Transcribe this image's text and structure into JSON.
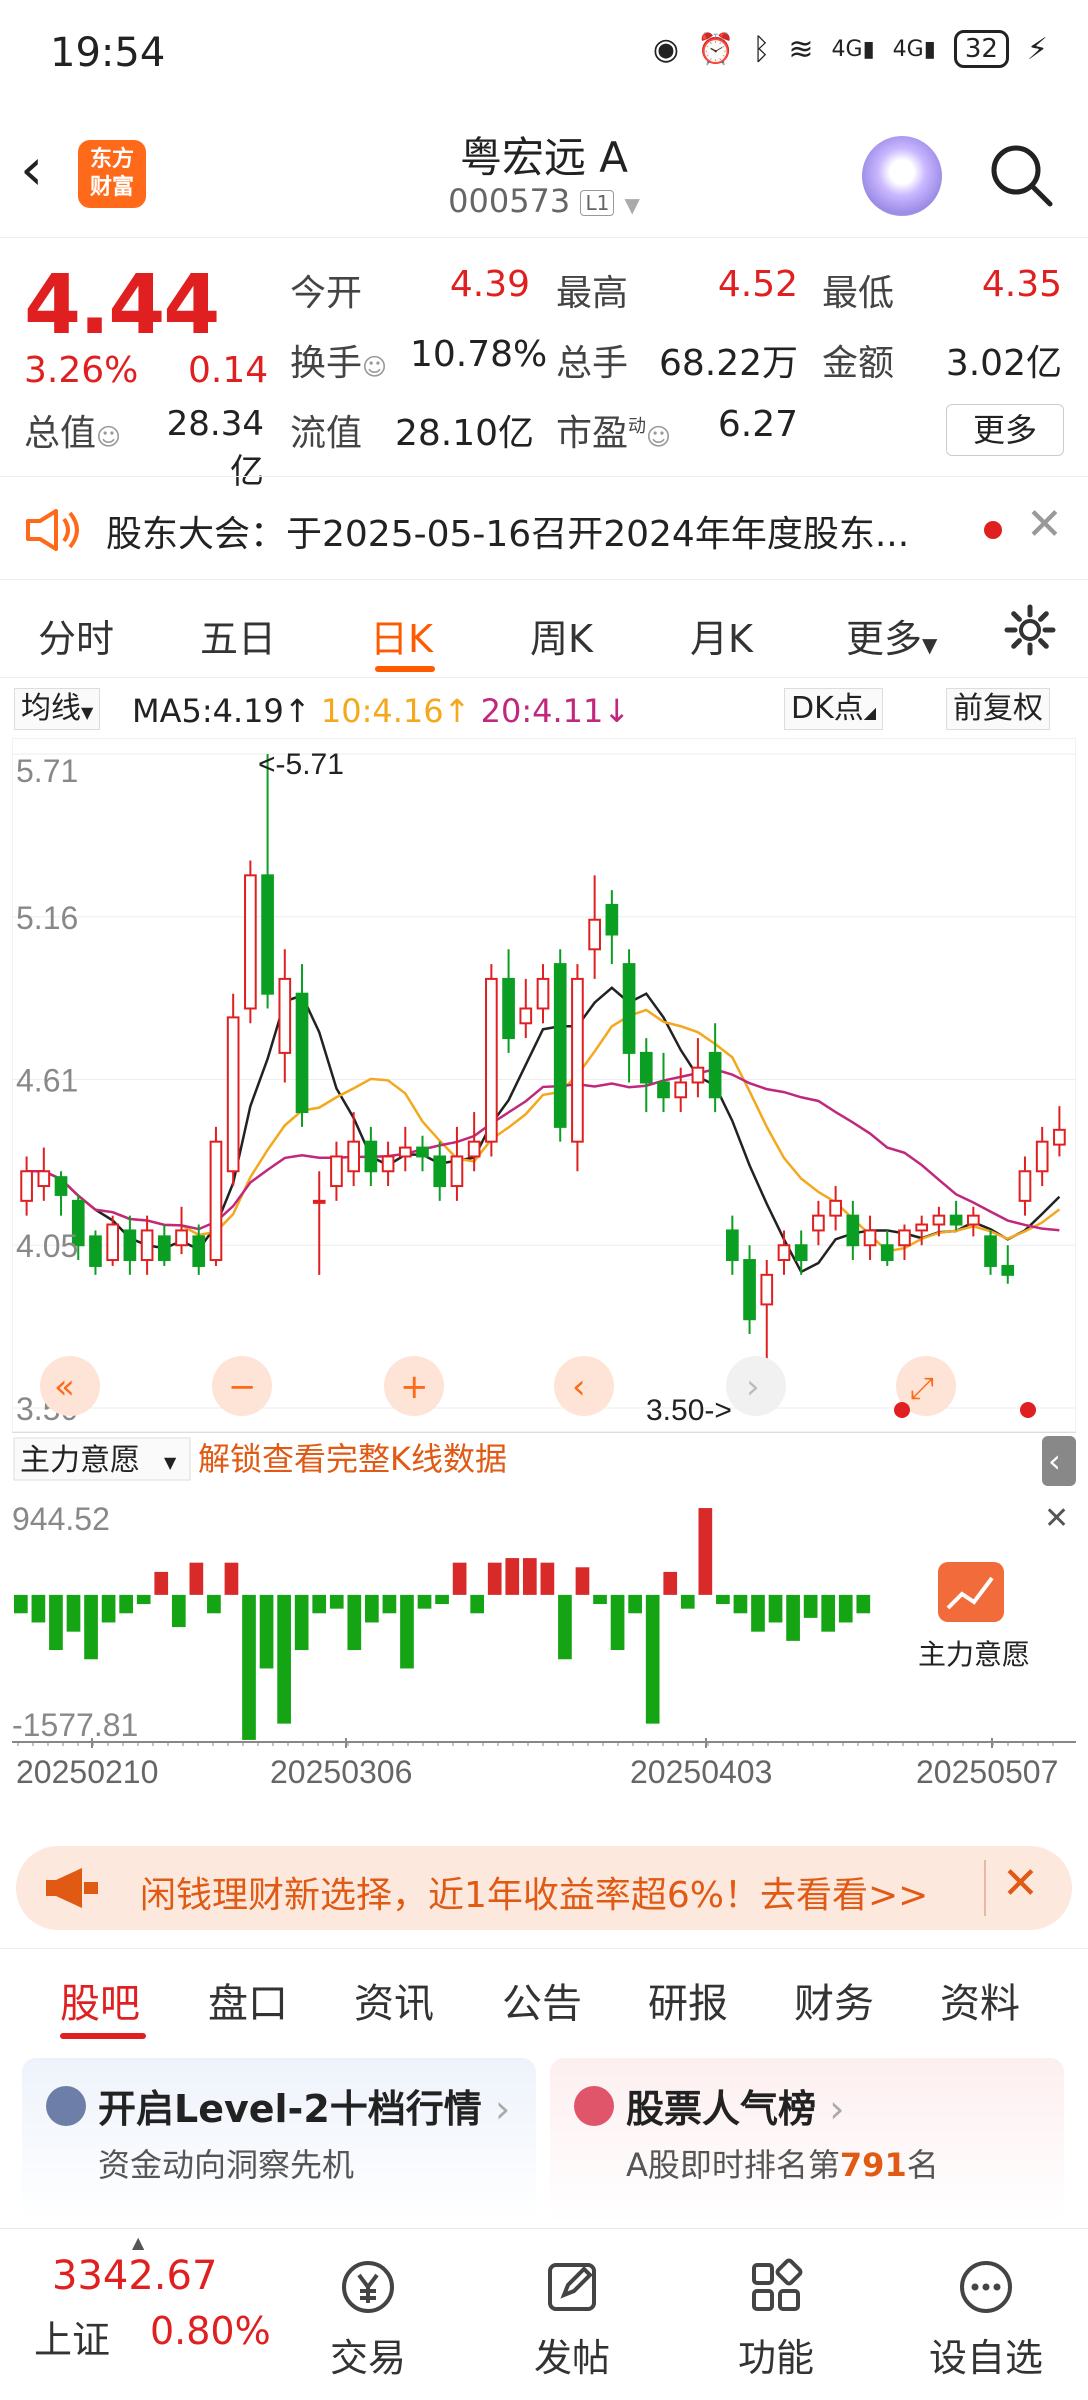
{
  "status_bar": {
    "time": "19:54",
    "signal_1": "4G",
    "signal_2": "4G",
    "battery": "32"
  },
  "header": {
    "title": "粤宏远 A",
    "code": "000573",
    "level_badge": "L1",
    "logo_line1": "东方",
    "logo_line2": "财富"
  },
  "quote": {
    "price": "4.44",
    "change_pct": "3.26%",
    "change_abs": "0.14",
    "open_label": "今开",
    "open": "4.39",
    "high_label": "最高",
    "high": "4.52",
    "low_label": "最低",
    "low": "4.35",
    "turnover_label": "换手",
    "turnover": "10.78%",
    "volume_label": "总手",
    "volume": "68.22万",
    "amount_label": "金额",
    "amount": "3.02亿",
    "mktcap_label": "总值",
    "mktcap": "28.34亿",
    "float_label": "流值",
    "float": "28.10亿",
    "pe_label": "市盈",
    "pe_sup": "动",
    "pe": "6.27",
    "more": "更多"
  },
  "notice": {
    "text": "股东大会：于2025-05-16召开2024年年度股东..."
  },
  "period_tabs": [
    "分时",
    "五日",
    "日K",
    "周K",
    "月K",
    "更多"
  ],
  "active_period": "日K",
  "ma_bar": {
    "selector": "均线",
    "ma5": "MA5:4.19",
    "ma10": "10:4.16",
    "ma20": "20:4.11",
    "dk": "DK点",
    "adjust": "前复权"
  },
  "chart_data": [
    {
      "type": "candlestick",
      "price_axis_labels": [
        "5.71",
        "5.16",
        "4.61",
        "4.05",
        "3.50"
      ],
      "ylim": [
        3.5,
        5.71
      ],
      "max_marker": "<-5.71",
      "min_marker": "3.50->",
      "date_labels": [
        "20250210",
        "20250306",
        "20250403",
        "20250507"
      ],
      "candles": [
        {
          "o": 4.2,
          "c": 4.3,
          "h": 4.35,
          "l": 4.15
        },
        {
          "o": 4.25,
          "c": 4.3,
          "h": 4.38,
          "l": 4.2
        },
        {
          "o": 4.28,
          "c": 4.22,
          "h": 4.3,
          "l": 4.15
        },
        {
          "o": 4.2,
          "c": 4.05,
          "h": 4.22,
          "l": 4.0
        },
        {
          "o": 4.08,
          "c": 3.98,
          "h": 4.1,
          "l": 3.95
        },
        {
          "o": 4.0,
          "c": 4.12,
          "h": 4.15,
          "l": 3.98
        },
        {
          "o": 4.1,
          "c": 4.0,
          "h": 4.15,
          "l": 3.95
        },
        {
          "o": 4.0,
          "c": 4.1,
          "h": 4.15,
          "l": 3.95
        },
        {
          "o": 4.08,
          "c": 4.0,
          "h": 4.12,
          "l": 3.98
        },
        {
          "o": 4.05,
          "c": 4.1,
          "h": 4.18,
          "l": 4.02
        },
        {
          "o": 4.08,
          "c": 3.98,
          "h": 4.12,
          "l": 3.95
        },
        {
          "o": 4.0,
          "c": 4.4,
          "h": 4.45,
          "l": 3.98
        },
        {
          "o": 4.3,
          "c": 4.82,
          "h": 4.9,
          "l": 4.25
        },
        {
          "o": 4.85,
          "c": 5.3,
          "h": 5.35,
          "l": 4.8
        },
        {
          "o": 5.3,
          "c": 4.9,
          "h": 5.71,
          "l": 4.85
        },
        {
          "o": 4.7,
          "c": 4.95,
          "h": 5.05,
          "l": 4.6
        },
        {
          "o": 4.9,
          "c": 4.5,
          "h": 5.0,
          "l": 4.45
        },
        {
          "o": 4.2,
          "c": 4.2,
          "h": 4.3,
          "l": 3.95
        },
        {
          "o": 4.25,
          "c": 4.35,
          "h": 4.4,
          "l": 4.2
        },
        {
          "o": 4.3,
          "c": 4.4,
          "h": 4.5,
          "l": 4.25
        },
        {
          "o": 4.4,
          "c": 4.3,
          "h": 4.45,
          "l": 4.25
        },
        {
          "o": 4.3,
          "c": 4.35,
          "h": 4.4,
          "l": 4.25
        },
        {
          "o": 4.35,
          "c": 4.38,
          "h": 4.45,
          "l": 4.3
        },
        {
          "o": 4.38,
          "c": 4.35,
          "h": 4.42,
          "l": 4.3
        },
        {
          "o": 4.35,
          "c": 4.25,
          "h": 4.4,
          "l": 4.2
        },
        {
          "o": 4.25,
          "c": 4.35,
          "h": 4.45,
          "l": 4.2
        },
        {
          "o": 4.35,
          "c": 4.4,
          "h": 4.5,
          "l": 4.3
        },
        {
          "o": 4.4,
          "c": 4.95,
          "h": 5.0,
          "l": 4.35
        },
        {
          "o": 4.95,
          "c": 4.75,
          "h": 5.05,
          "l": 4.7
        },
        {
          "o": 4.8,
          "c": 4.85,
          "h": 4.95,
          "l": 4.75
        },
        {
          "o": 4.85,
          "c": 4.95,
          "h": 5.0,
          "l": 4.8
        },
        {
          "o": 5.0,
          "c": 4.45,
          "h": 5.05,
          "l": 4.4
        },
        {
          "o": 4.4,
          "c": 4.95,
          "h": 5.0,
          "l": 4.3
        },
        {
          "o": 5.05,
          "c": 5.15,
          "h": 5.3,
          "l": 4.95
        },
        {
          "o": 5.2,
          "c": 5.1,
          "h": 5.25,
          "l": 5.0
        },
        {
          "o": 5.0,
          "c": 4.7,
          "h": 5.05,
          "l": 4.6
        },
        {
          "o": 4.7,
          "c": 4.6,
          "h": 4.75,
          "l": 4.5
        },
        {
          "o": 4.6,
          "c": 4.55,
          "h": 4.7,
          "l": 4.5
        },
        {
          "o": 4.55,
          "c": 4.6,
          "h": 4.65,
          "l": 4.5
        },
        {
          "o": 4.6,
          "c": 4.65,
          "h": 4.75,
          "l": 4.55
        },
        {
          "o": 4.7,
          "c": 4.55,
          "h": 4.8,
          "l": 4.5
        },
        {
          "o": 4.1,
          "c": 4.0,
          "h": 4.15,
          "l": 3.95
        },
        {
          "o": 4.0,
          "c": 3.8,
          "h": 4.05,
          "l": 3.75
        },
        {
          "o": 3.85,
          "c": 3.95,
          "h": 4.0,
          "l": 3.5
        },
        {
          "o": 4.0,
          "c": 4.05,
          "h": 4.1,
          "l": 3.95
        },
        {
          "o": 4.05,
          "c": 4.0,
          "h": 4.1,
          "l": 3.95
        },
        {
          "o": 4.1,
          "c": 4.15,
          "h": 4.2,
          "l": 4.05
        },
        {
          "o": 4.15,
          "c": 4.2,
          "h": 4.25,
          "l": 4.1
        },
        {
          "o": 4.15,
          "c": 4.05,
          "h": 4.2,
          "l": 4.0
        },
        {
          "o": 4.05,
          "c": 4.1,
          "h": 4.15,
          "l": 4.0
        },
        {
          "o": 4.05,
          "c": 4.0,
          "h": 4.1,
          "l": 3.98
        },
        {
          "o": 4.05,
          "c": 4.1,
          "h": 4.12,
          "l": 4.0
        },
        {
          "o": 4.1,
          "c": 4.12,
          "h": 4.15,
          "l": 4.05
        },
        {
          "o": 4.12,
          "c": 4.15,
          "h": 4.18,
          "l": 4.08
        },
        {
          "o": 4.15,
          "c": 4.12,
          "h": 4.2,
          "l": 4.1
        },
        {
          "o": 4.12,
          "c": 4.15,
          "h": 4.18,
          "l": 4.08
        },
        {
          "o": 4.08,
          "c": 3.98,
          "h": 4.1,
          "l": 3.95
        },
        {
          "o": 3.98,
          "c": 3.95,
          "h": 4.05,
          "l": 3.92
        },
        {
          "o": 4.2,
          "c": 4.3,
          "h": 4.35,
          "l": 4.15
        },
        {
          "o": 4.3,
          "c": 4.4,
          "h": 4.45,
          "l": 4.25
        },
        {
          "o": 4.39,
          "c": 4.44,
          "h": 4.52,
          "l": 4.35
        }
      ]
    },
    {
      "type": "bar",
      "title": "主力意愿",
      "link_text": "解锁查看完整K线数据",
      "ylabels": [
        "944.52",
        "-1577.81"
      ],
      "ylim": [
        -1577.81,
        944.52
      ],
      "values": [
        -200,
        -300,
        -600,
        -400,
        -700,
        -300,
        -200,
        -100,
        250,
        -350,
        350,
        -200,
        350,
        -1577,
        -800,
        -1400,
        -600,
        -200,
        -150,
        -600,
        -300,
        -200,
        -800,
        -150,
        -100,
        350,
        -200,
        350,
        400,
        400,
        350,
        -700,
        300,
        -100,
        -600,
        -200,
        -1400,
        250,
        -150,
        944,
        -100,
        -200,
        -400,
        -300,
        -500,
        -250,
        -400,
        -300,
        -200
      ]
    }
  ],
  "chart_controls": {
    "overlay_label": "主力意愿"
  },
  "promo": {
    "text": "闲钱理财新选择，近1年收益率超6%！去看看>>"
  },
  "section_tabs": [
    "股吧",
    "盘口",
    "资讯",
    "公告",
    "研报",
    "财务",
    "资料"
  ],
  "cards": [
    {
      "title": "开启Level-2十档行情",
      "subtitle": "资金动向洞察先机",
      "accent": "#6d7fa8"
    },
    {
      "title": "股票人气榜",
      "subtitle_prefix": "A股即时排名第",
      "rank": "791",
      "subtitle_suffix": "名",
      "accent": "#e0556a"
    }
  ],
  "bottom_nav": {
    "index_value": "3342.67",
    "index_name": "上证",
    "index_change": "0.80%",
    "items": [
      "交易",
      "发帖",
      "功能",
      "设自选"
    ]
  },
  "colors": {
    "up": "#e02020",
    "down": "#0a9e22",
    "accent": "#ff5a00",
    "ma5": "#222222",
    "ma10": "#f4a81d",
    "ma20": "#c0287e"
  }
}
